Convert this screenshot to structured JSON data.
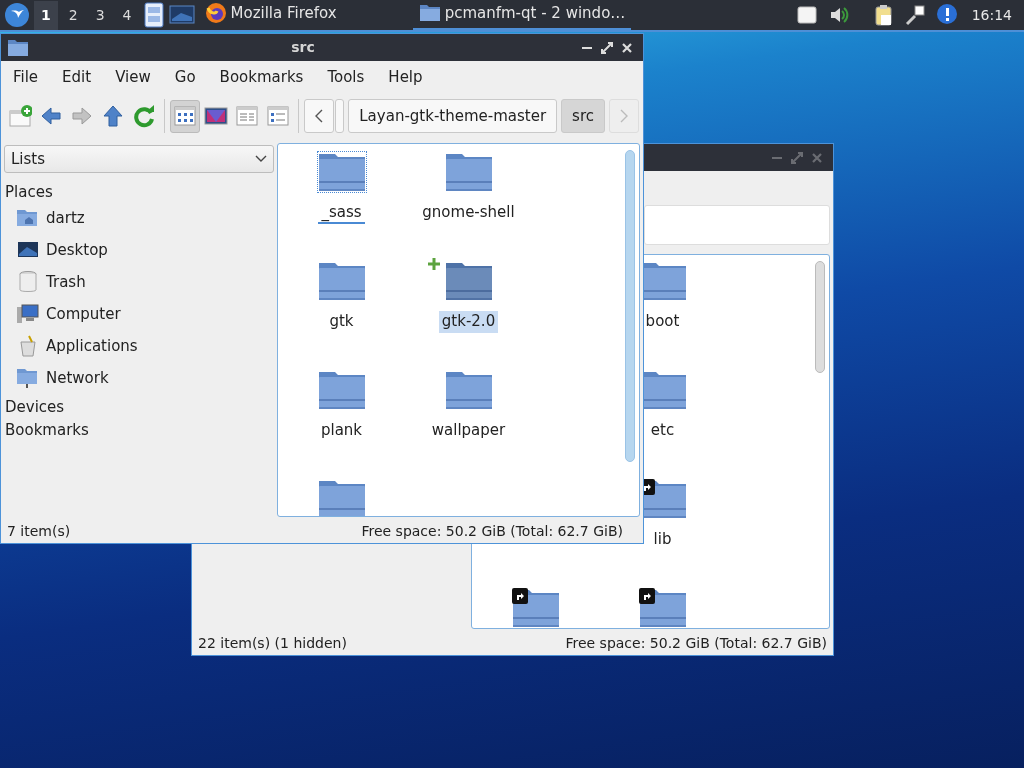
{
  "taskbar": {
    "workspaces": [
      {
        "label": "1",
        "selected": true
      },
      {
        "label": "2",
        "selected": false
      },
      {
        "label": "3",
        "selected": false
      },
      {
        "label": "4",
        "selected": false
      }
    ],
    "tasks": [
      {
        "kind": "browser",
        "label": "Mozilla Firefox",
        "selected": false
      },
      {
        "kind": "folder",
        "label": "pcmanfm-qt - 2 windo…",
        "selected": true
      }
    ],
    "clock": "16:14"
  },
  "back_window": {
    "files": [
      {
        "name": "boot"
      },
      {
        "name": "etc"
      },
      {
        "name": "lib",
        "link": true
      },
      {
        "link": true
      },
      {
        "link": true
      }
    ],
    "status_left": "22 item(s) (1 hidden)",
    "status_right": "Free space: 50.2 GiB (Total: 62.7 GiB)"
  },
  "front_window": {
    "title": "src",
    "menu": [
      "File",
      "Edit",
      "View",
      "Go",
      "Bookmarks",
      "Tools",
      "Help"
    ],
    "view_modes": [
      {
        "selected": true
      },
      {
        "selected": false
      },
      {
        "selected": false
      },
      {
        "selected": false
      }
    ],
    "path": [
      {
        "label": "Layan-gtk-theme-master",
        "selected": false
      },
      {
        "label": "src",
        "selected": true
      }
    ],
    "side_panel": {
      "dropdown": "Lists",
      "sections": [
        {
          "label": "Places",
          "items": [
            {
              "kind": "home",
              "label": "dartz"
            },
            {
              "kind": "desktop",
              "label": "Desktop"
            },
            {
              "kind": "trash",
              "label": "Trash"
            },
            {
              "kind": "computer",
              "label": "Computer"
            },
            {
              "kind": "applications",
              "label": "Applications"
            },
            {
              "kind": "network",
              "label": "Network"
            }
          ]
        },
        {
          "label": "Devices"
        },
        {
          "label": "Bookmarks"
        }
      ]
    },
    "files": [
      {
        "name": "_sass",
        "selected": false,
        "focused": true
      },
      {
        "name": "gnome-shell",
        "selected": false,
        "focused": false
      },
      {
        "name": "gtk",
        "selected": false,
        "focused": false
      },
      {
        "name": "gtk-2.0",
        "selected": true,
        "focused": false,
        "hovered": true
      },
      {
        "name": "plank",
        "selected": false,
        "focused": false
      },
      {
        "name": "wallpaper",
        "selected": false,
        "focused": false
      },
      {
        "selected": false,
        "focused": false
      }
    ],
    "status_left": "7 item(s)",
    "status_right": "Free space: 50.2 GiB (Total: 62.7 GiB)"
  }
}
